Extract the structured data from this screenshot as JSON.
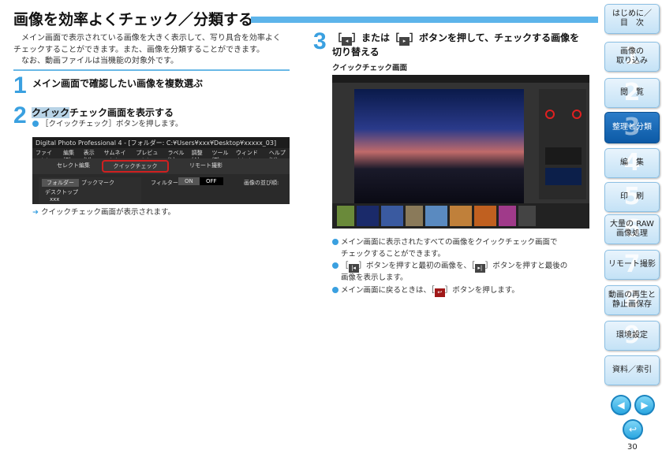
{
  "page": {
    "title": "画像を効率よくチェック／分類する",
    "intro": [
      "メイン画面で表示されている画像を大きく表示して、写り具合を効率よく",
      "チェックすることができます。また、画像を分類することができます。",
      "なお、動画ファイルは当機能の対象外です。"
    ],
    "page_number": "30"
  },
  "steps": [
    {
      "num": "1",
      "heading": "メイン画面で確認したい画像を複数選ぶ"
    },
    {
      "num": "2",
      "heading_hl": "クイック",
      "heading_rest": "チェック画面を表示する",
      "bullet": "［クイックチェック］ボタンを押します。",
      "result": "クイックチェック画面が表示されます。"
    },
    {
      "num": "3",
      "heading_a": "［",
      "heading_b": "］または［",
      "heading_c": "］ボタンを押して、チェックする画像を",
      "heading_d": "切り替える",
      "caption": "クイックチェック画面",
      "bullets": [
        {
          "a": "メイン画面に表示されたすべての画像をクイックチェック画面で",
          "b": "チェックすることができます。"
        },
        {
          "a": "［",
          "b": "］ボタンを押すと最初の画像を、［",
          "c": "］ボタンを押すと最後の",
          "d": "画像を表示します。"
        },
        {
          "a": "メイン画面に戻るときは、［",
          "b": "］ボタンを押します。"
        }
      ]
    }
  ],
  "dpp": {
    "window_title": "Digital Photo Professional 4 - [フォルダー: C:¥Users¥xxx¥Desktop¥xxxxx_03]",
    "menu": [
      "ファイル(F)",
      "編集(E)",
      "表示(V)",
      "サムネイル(N)",
      "プレビュー(P)",
      "ラベル(L)",
      "調整(A)",
      "ツール(T)",
      "ウィンドウ(W)",
      "ヘルプ(H)"
    ],
    "tabs": [
      "セレクト編集",
      "クイックチェック",
      "リモート撮影"
    ],
    "panel_tabs": [
      "フォルダー",
      "ブックマーク"
    ],
    "filter_label": "フィルター",
    "on": "ON",
    "off": "OFF",
    "sort_label": "画像の並び順:",
    "tree": [
      "デスクトップ",
      "xxx"
    ]
  },
  "sidebar": [
    {
      "label": "はじめに／\n目　次",
      "num": ""
    },
    {
      "label": "画像の\n取り込み",
      "num": "1"
    },
    {
      "label": "閲　覧",
      "num": "2"
    },
    {
      "label": "整理と分類",
      "num": "3",
      "active": true
    },
    {
      "label": "編　集",
      "num": "4"
    },
    {
      "label": "印　刷",
      "num": "5"
    },
    {
      "label": "大量の RAW\n画像処理",
      "num": "6"
    },
    {
      "label": "リモート撮影",
      "num": "7"
    },
    {
      "label": "動画の再生と\n静止画保存",
      "num": "8"
    },
    {
      "label": "環境設定",
      "num": "9"
    },
    {
      "label": "資料／索引",
      "num": ""
    }
  ],
  "colors": {
    "accent": "#3aa0e0",
    "active_tab": "#0c5aa6"
  }
}
